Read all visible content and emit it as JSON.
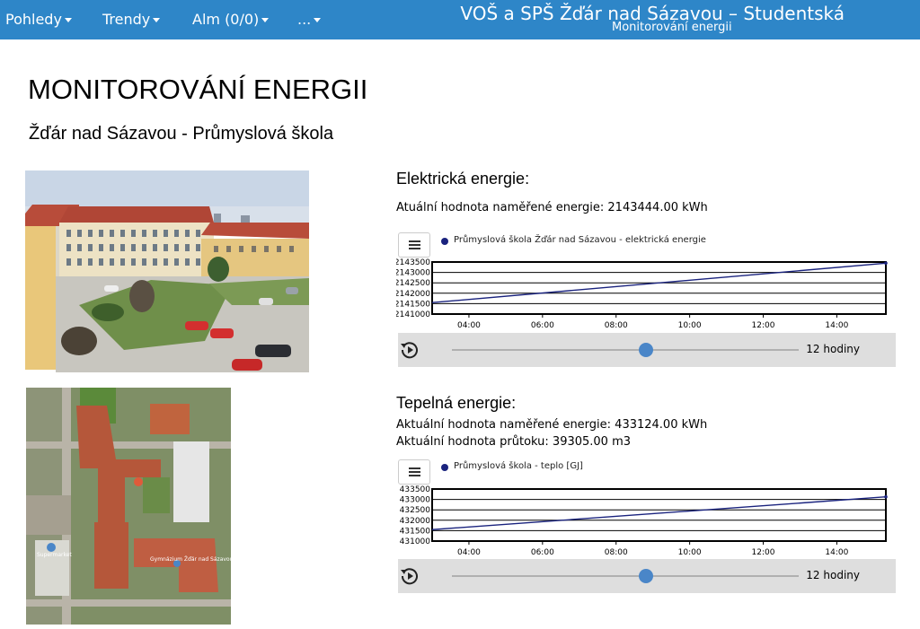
{
  "nav": {
    "items": [
      {
        "label": "Pohledy"
      },
      {
        "label": "Trendy"
      },
      {
        "label": "Alm (0/0)"
      },
      {
        "label": "..."
      }
    ],
    "brand_title": "VOŠ a SPŠ Žďár nad Sázavou – Studentská",
    "brand_subtitle": "Monitorování energii"
  },
  "page": {
    "title": "MONITOROVÁNÍ ENERGII",
    "subtitle": "Žďár nad Sázavou - Průmyslová škola"
  },
  "aerial_labels": [
    "Gymnázium Žďár nad Sázavou",
    "Supermarket"
  ],
  "electric": {
    "heading": "Elektrická energie:",
    "value_line": "Atuální hodnota naměřené energie: 2143444.00 kWh",
    "slider_label": "12 hodiny",
    "slider_value": 0.56
  },
  "heat": {
    "heading": "Tepelná energie:",
    "value_line": "Aktuální hodnota naměřené energie: 433124.00 kWh",
    "flow_line": "Aktuální hodnota průtoku: 39305.00 m3",
    "slider_label": "12 hodiny",
    "slider_value": 0.56
  },
  "colors": {
    "nav_bg": "#2e86c8",
    "series": "#1a237e",
    "slider_thumb": "#4a86c8"
  },
  "chart_data": [
    {
      "type": "line",
      "legend": "Průmyslová škola Žďár nad Sázavou - elektrická energie",
      "x": [
        "03:00",
        "15:20"
      ],
      "series": [
        {
          "name": "Průmyslová škola Žďár nad Sázavou - elektrická energie",
          "x": [
            "03:00",
            "15:20"
          ],
          "values": [
            2141550,
            2143444
          ]
        }
      ],
      "x_ticks": [
        "04:00",
        "06:00",
        "08:00",
        "10:00",
        "12:00",
        "14:00"
      ],
      "y_ticks": [
        "2141000",
        "2141500",
        "2142000",
        "2142500",
        "2143000",
        "2143500"
      ],
      "ylim": [
        2141000,
        2143500
      ],
      "grid": true
    },
    {
      "type": "line",
      "legend": "Průmyslová škola - teplo [GJ]",
      "x": [
        "03:00",
        "15:20"
      ],
      "series": [
        {
          "name": "Průmyslová škola - teplo [GJ]",
          "x": [
            "03:00",
            "15:20"
          ],
          "values": [
            431550,
            433124
          ]
        }
      ],
      "x_ticks": [
        "04:00",
        "06:00",
        "08:00",
        "10:00",
        "12:00",
        "14:00"
      ],
      "y_ticks": [
        "431000",
        "431500",
        "432000",
        "432500",
        "433000",
        "433500"
      ],
      "ylim": [
        431000,
        433500
      ],
      "grid": true
    }
  ]
}
